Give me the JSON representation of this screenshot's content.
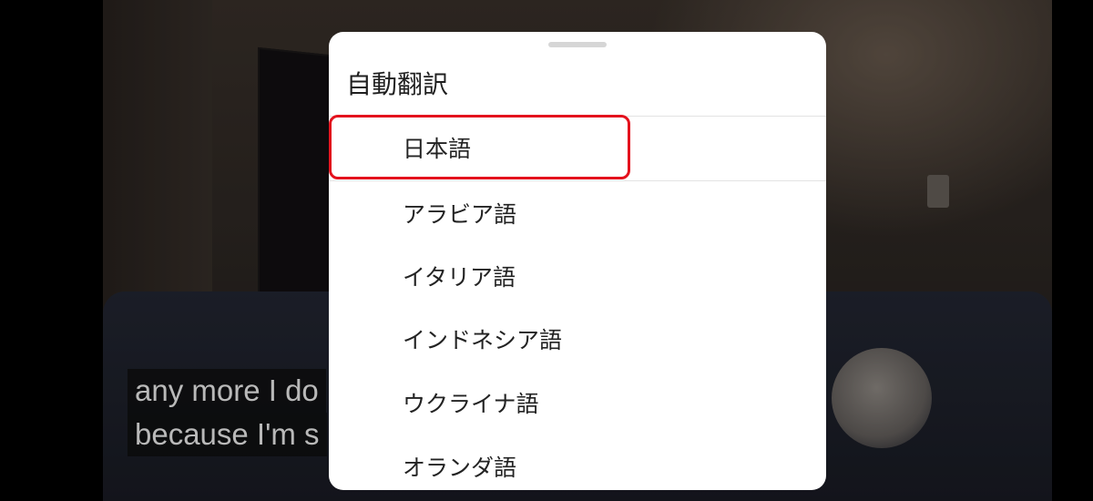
{
  "captions": {
    "line1": "any more I do",
    "line2": "because I'm s"
  },
  "sheet": {
    "title": "自動翻訳",
    "items": [
      {
        "label": "日本語",
        "selected": true
      },
      {
        "label": "アラビア語"
      },
      {
        "label": "イタリア語"
      },
      {
        "label": "インドネシア語"
      },
      {
        "label": "ウクライナ語"
      },
      {
        "label": "オランダ語"
      }
    ]
  },
  "colors": {
    "highlight": "#e4121d",
    "sheet_background": "#ffffff",
    "caption_text": "#b9b9b9"
  }
}
